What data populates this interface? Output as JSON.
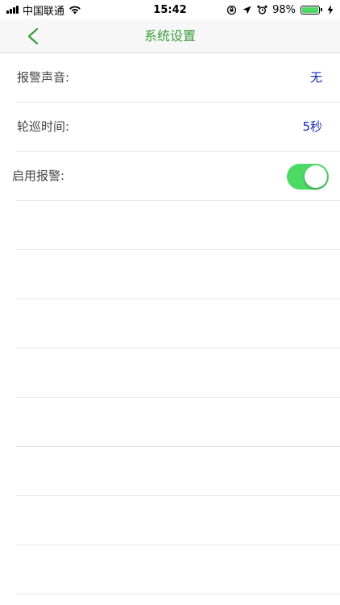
{
  "status_bar": {
    "carrier": "中国联通",
    "time": "15:42",
    "battery_percent": "98%",
    "battery_level": 0.98,
    "icons": [
      "signal-icon",
      "wifi-icon",
      "orientation-lock-icon",
      "location-icon",
      "alarm-icon",
      "battery-icon",
      "charging-bolt-icon"
    ]
  },
  "nav": {
    "title": "系统设置",
    "back_icon": "chevron-left-icon",
    "accent_color": "#3a9c3a"
  },
  "settings": {
    "alarm_sound": {
      "label": "报警声音:",
      "value": "无"
    },
    "patrol_time": {
      "label": "轮巡时间:",
      "value": "5秒"
    },
    "enable_alarm": {
      "label": "启用报警:",
      "toggle_on": true
    }
  },
  "colors": {
    "value_text": "#1a2bb5",
    "toggle_on": "#4cd964"
  }
}
